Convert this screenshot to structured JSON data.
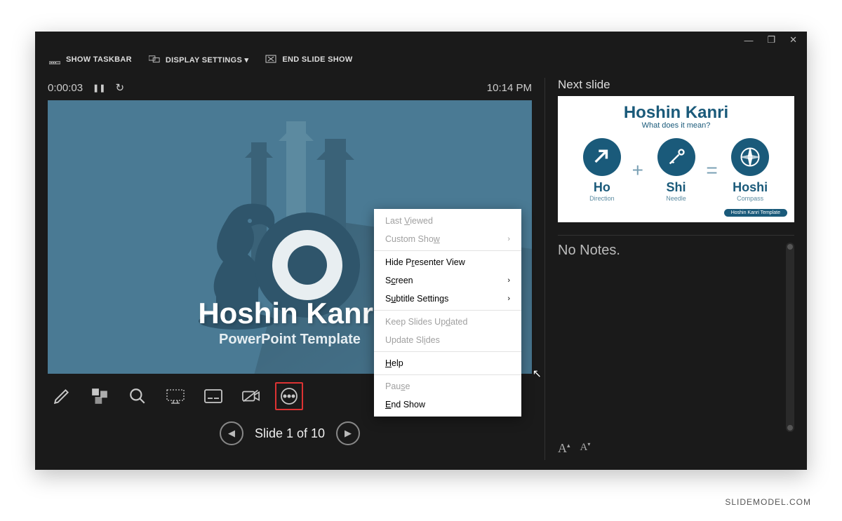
{
  "window": {
    "minimize": "—",
    "restore": "❐",
    "close": "✕"
  },
  "toolbar": {
    "show_taskbar": "SHOW TASKBAR",
    "display_settings": "DISPLAY SETTINGS ▾",
    "end_slide_show": "END SLIDE SHOW"
  },
  "timer": {
    "elapsed": "0:00:03",
    "pause_glyph": "❚❚",
    "restart_glyph": "↻",
    "clock": "10:14 PM"
  },
  "slide": {
    "title": "Hoshin Kanri",
    "subtitle": "PowerPoint Template"
  },
  "context_menu": {
    "last_viewed": "Last Viewed",
    "custom_show": "Custom Show",
    "hide_presenter_view": "Hide Presenter View",
    "screen": "Screen",
    "subtitle_settings": "Subtitle Settings",
    "keep_slides_updated": "Keep Slides Updated",
    "update_slides": "Update Slides",
    "help": "Help",
    "pause": "Pause",
    "end_show": "End Show",
    "submenu_arrow": "›"
  },
  "pager": {
    "label": "Slide 1 of 10",
    "prev": "◀",
    "next": "▶"
  },
  "right": {
    "next_slide_label": "Next slide",
    "no_notes": "No Notes."
  },
  "next_slide": {
    "title": "Hoshin Kanri",
    "subtitle": "What does it mean?",
    "items": [
      {
        "label": "Ho",
        "mini": "Direction"
      },
      {
        "label": "Shi",
        "mini": "Needle"
      },
      {
        "label": "Hoshi",
        "mini": "Compass"
      }
    ],
    "op_plus": "+",
    "op_eq": "=",
    "badge": "Hoshin Kanri Template"
  },
  "font_controls": {
    "increase": "A",
    "decrease": "A"
  },
  "watermark": "SLIDEMODEL.COM"
}
